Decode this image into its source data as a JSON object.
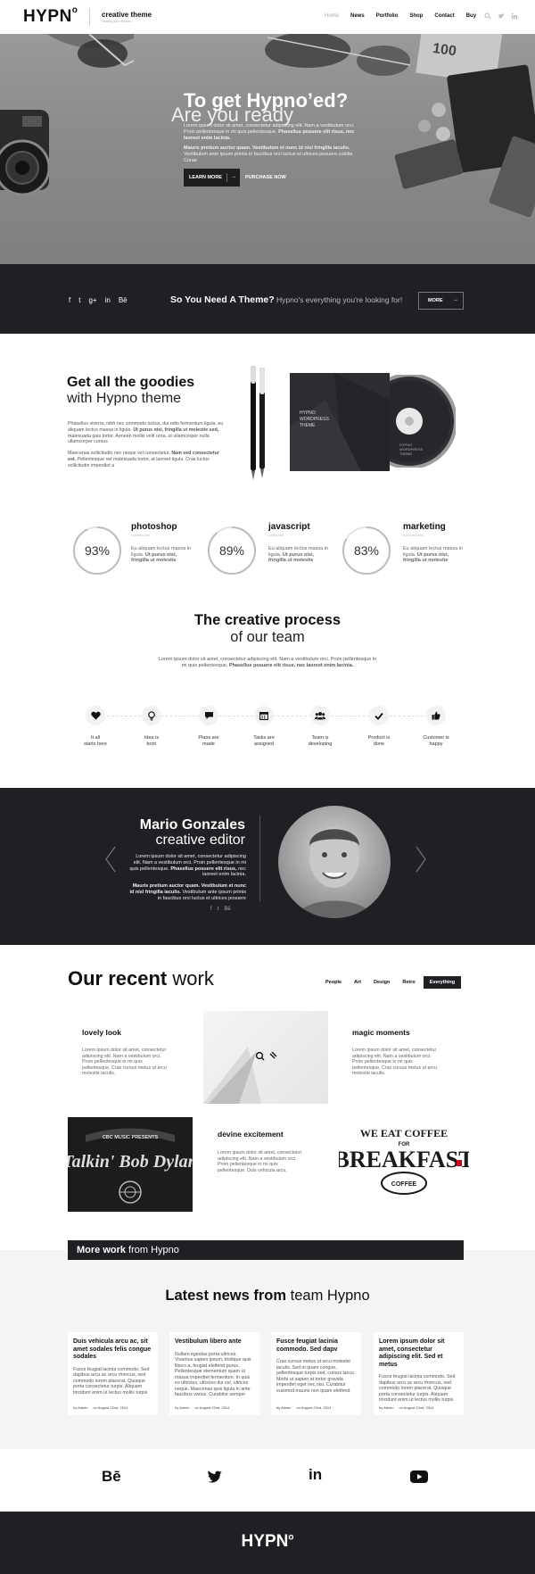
{
  "header": {
    "logo": "HYPN",
    "logo_sup": "o",
    "tagline_title": "creative theme",
    "tagline_sub": "creating your dreams",
    "nav": [
      "Home",
      "News",
      "Portfolio",
      "Shop",
      "Contact",
      "Buy"
    ],
    "icons": [
      "search-icon",
      "twitter-icon",
      "linkedin-icon"
    ]
  },
  "hero": {
    "question": "Are you ready",
    "headline": "To get Hypno’ed?",
    "p1_normal": "Lorem ipsum dolor sit amet, consectetur adipiscing elit. Nam a vestibulum orci. Proin pellentesque in mi quis pellentesque.",
    "p1_bold": "Phasellus posuere elit risus, nec laoreet enim lacinia.",
    "p2_bold": "Mauris pretium auctor quam. Vestibulum et nunc id nisl fringilla iaculis.",
    "p2_normal": "Vestibulum ante ipsum primis in faucibus orci luctus et ultrices posuere cubilia Curae",
    "learn_more": "LEARN MORE",
    "arrow": "→",
    "purchase": "PURCHASE NOW"
  },
  "band": {
    "social": [
      "f",
      "t",
      "g+",
      "in",
      "Bē"
    ],
    "title": "So You Need A Theme?",
    "subtitle": "Hypno's everything you're looking for!",
    "more": "MORE",
    "arrow": "→"
  },
  "goodies": {
    "title_bold": "Get all the goodies",
    "title_light": "with Hypno theme",
    "p1_normal": "Phasellus viverra, nibh nec commodo luctus, dui odio fermentum ligula, eu aliquam lectus massa in ligula.",
    "p1_bold": "Ut purus nisi, fringilla ut molestie sed,",
    "p1_tail": "malesuada quis tortor. Aenean mollis velit urna, ut ullamcorper nulla ullamcorper cursus",
    "p2_normal": "Maecenas sollicitudin nec neque vel consectetur.",
    "p2_bold": "Nam sed consectetur est.",
    "p2_tail": "Pellentesque vel malesuada tortor, at laoreet ligula. Cras luctus sollicitudin imperdiet a",
    "case_text": [
      "HYPNO",
      "WORDPRESS",
      "THEME"
    ],
    "disc_text": [
      "HYPNO",
      "WORDPRESS",
      "THEME"
    ]
  },
  "stats": [
    {
      "pct": "93%",
      "value": 93,
      "title": "photoshop",
      "sub": "company skill",
      "desc": "Eu aliquam lectus massa in ligula.",
      "desc_bold": "Ut purus nisi, fringilla ut molestie"
    },
    {
      "pct": "89%",
      "value": 89,
      "title": "javascript",
      "sub": "coding skill",
      "desc": "Eu aliquam lectus massa in ligula.",
      "desc_bold": "Ut purus nisi, fringilla ut molestie"
    },
    {
      "pct": "83%",
      "value": 83,
      "title": "marketing",
      "sub": "promotion skill",
      "desc": "Eu aliquam lectus massa in ligula.",
      "desc_bold": "Ut purus nisi, fringilla ut molestie"
    }
  ],
  "process": {
    "title_bold": "The creative process",
    "title_light": "of our team",
    "p_normal": "Lorem ipsum dolor sit amet, consectetur adipiscing elit. Nam a vestibulum orci. Proin pellentesque in mi quis pellentesque.",
    "p_bold": "Phasellus posuere elit risus, nec laoreet enim lacinia.",
    "steps": [
      {
        "icon": "heart-icon",
        "l1": "It all",
        "l2": "starts here"
      },
      {
        "icon": "lightbulb-icon",
        "l1": "Idea is",
        "l2": "born"
      },
      {
        "icon": "chat-icon",
        "l1": "Plans are",
        "l2": "made"
      },
      {
        "icon": "calendar-icon",
        "l1": "Tasks are",
        "l2": "assigned"
      },
      {
        "icon": "team-icon",
        "l1": "Team is",
        "l2": "developing"
      },
      {
        "icon": "check-icon",
        "l1": "Product is",
        "l2": "done"
      },
      {
        "icon": "thumbs-up-icon",
        "l1": "Customer is",
        "l2": "happy"
      }
    ]
  },
  "testimonial": {
    "name": "Mario Gonzales",
    "role": "creative editor",
    "p1_normal": "Lorem ipsum dolor sit amet, consectetur adipiscing elit. Nam a vestibulum orci. Proin pellentesque in mi quis pellentesque.",
    "p1_bold": "Phasellus posuere elit risus,",
    "p1_tail": "nec laoreet enim lacinia.",
    "p2_bold": "Mauris pretium auctor quam. Vestibulum et nunc id nisl fringilla iaculis.",
    "p2_normal": "Vestibulum ante ipsum primis in faucibus orci luctus et ultrices posuere",
    "social": [
      "f",
      "t",
      "Bē"
    ],
    "prev": "‹",
    "next": "›"
  },
  "recent_work": {
    "title_bold": "Our recent",
    "title_light": "work",
    "filters": [
      "People",
      "Art",
      "Design",
      "Retro",
      "Everything"
    ],
    "active_filter": "Everything",
    "items": [
      {
        "title": "lovely look",
        "desc": "Lorem ipsum dolor sit amet, consectetur adipiscing elit. Nam a vestibulum orci. Proin pellentesque in mi quis pellentesque. Cras cursus metus ut arcu molestie iaculis."
      },
      {
        "title": "magic moments",
        "desc": "Lorem ipsum dolor sit amet, consectetur adipiscing elit. Nam a vestibulum orci. Proin pellentesque in mi quis pellentesque. Cras cursus metus ut arcu molestie iaculis."
      },
      {
        "title": "devine excitement",
        "desc": "Lorem ipsum dolor sit amet, consectetur adipiscing elit. Nam a vestibulum orci. Proin pellentesque in mi quis pellentesque. Duis vehicula arcu."
      }
    ],
    "img2_text": [
      "CBC MUSIC PRESENTS",
      "Talkin' Bob Dylan"
    ],
    "img3_text": [
      "WE EAT COFFEE",
      "FOR",
      "BREAKFAST",
      "COFFEE"
    ],
    "more_bold": "More work",
    "more_light": "from Hypno"
  },
  "news": {
    "title_bold": "Latest news from",
    "title_light": "team Hypno",
    "posts": [
      {
        "title": "Duis vehicula arcu ac, sit amet sodales felis congue sodales",
        "body": "Fusce feugiat lacinia commodo. Sed dapibus arcu ac arcu rhoncus, sed commodo lorem placerat. Quisque porta consectetur turpis. Aliquam tincidunt enim ut lectus mollis turpis",
        "author": "by Admin",
        "date": "on August 22nd, 2014"
      },
      {
        "title": "Vestibulum libero ante",
        "body": "Nullam egestas porta ultrices. Vivamus sapien ipsum, tristique quis libero a, feugiat eleifend purus. Pellentesque elementum quam ut massa imperdiet fermentum. In quis ex ultricies, ultricies dui vel, ultrices neque. Maecenas quis ligula in ante faucibus varius. Curabitur semper",
        "author": "by Admin",
        "date": "on August 22nd, 2014"
      },
      {
        "title": "Fusce feugiat lacinia commodo. Sed dapv",
        "body": "Cras cursus metus ut arcu molestie iaculis. Sed in quam congue, pellentesque turpis sed, cursus lacus. Morbi ut sapien at tortor gravida imperdiet eget nec nisi. Curabitur euismod mauris non quam eleifend",
        "author": "by Admin",
        "date": "on August 22nd, 2014"
      },
      {
        "title": "Lorem ipsum dolor sit amet, consectetur adipiscing elit. Sed et metus",
        "body": "Fusce feugiat lacinia commodo. Sed dapibus arcu ac arcu rhoncus, sed commodo lorem placerat. Quisque porta consectetur turpis. Aliquam tincidunt enim ut lectus mollis turpis",
        "author": "by Admin",
        "date": "on August 22nd, 2014"
      }
    ]
  },
  "footer": {
    "icons": [
      "behance-icon",
      "twitter-icon",
      "linkedin-icon",
      "youtube-icon"
    ],
    "behance": "Bē",
    "linkedin": "in",
    "logo": "HYPN",
    "logo_sup": "o"
  },
  "colors": {
    "dark": "#1f2023",
    "light_bg": "#f4f4f4",
    "accent_red": "#d0021b"
  }
}
